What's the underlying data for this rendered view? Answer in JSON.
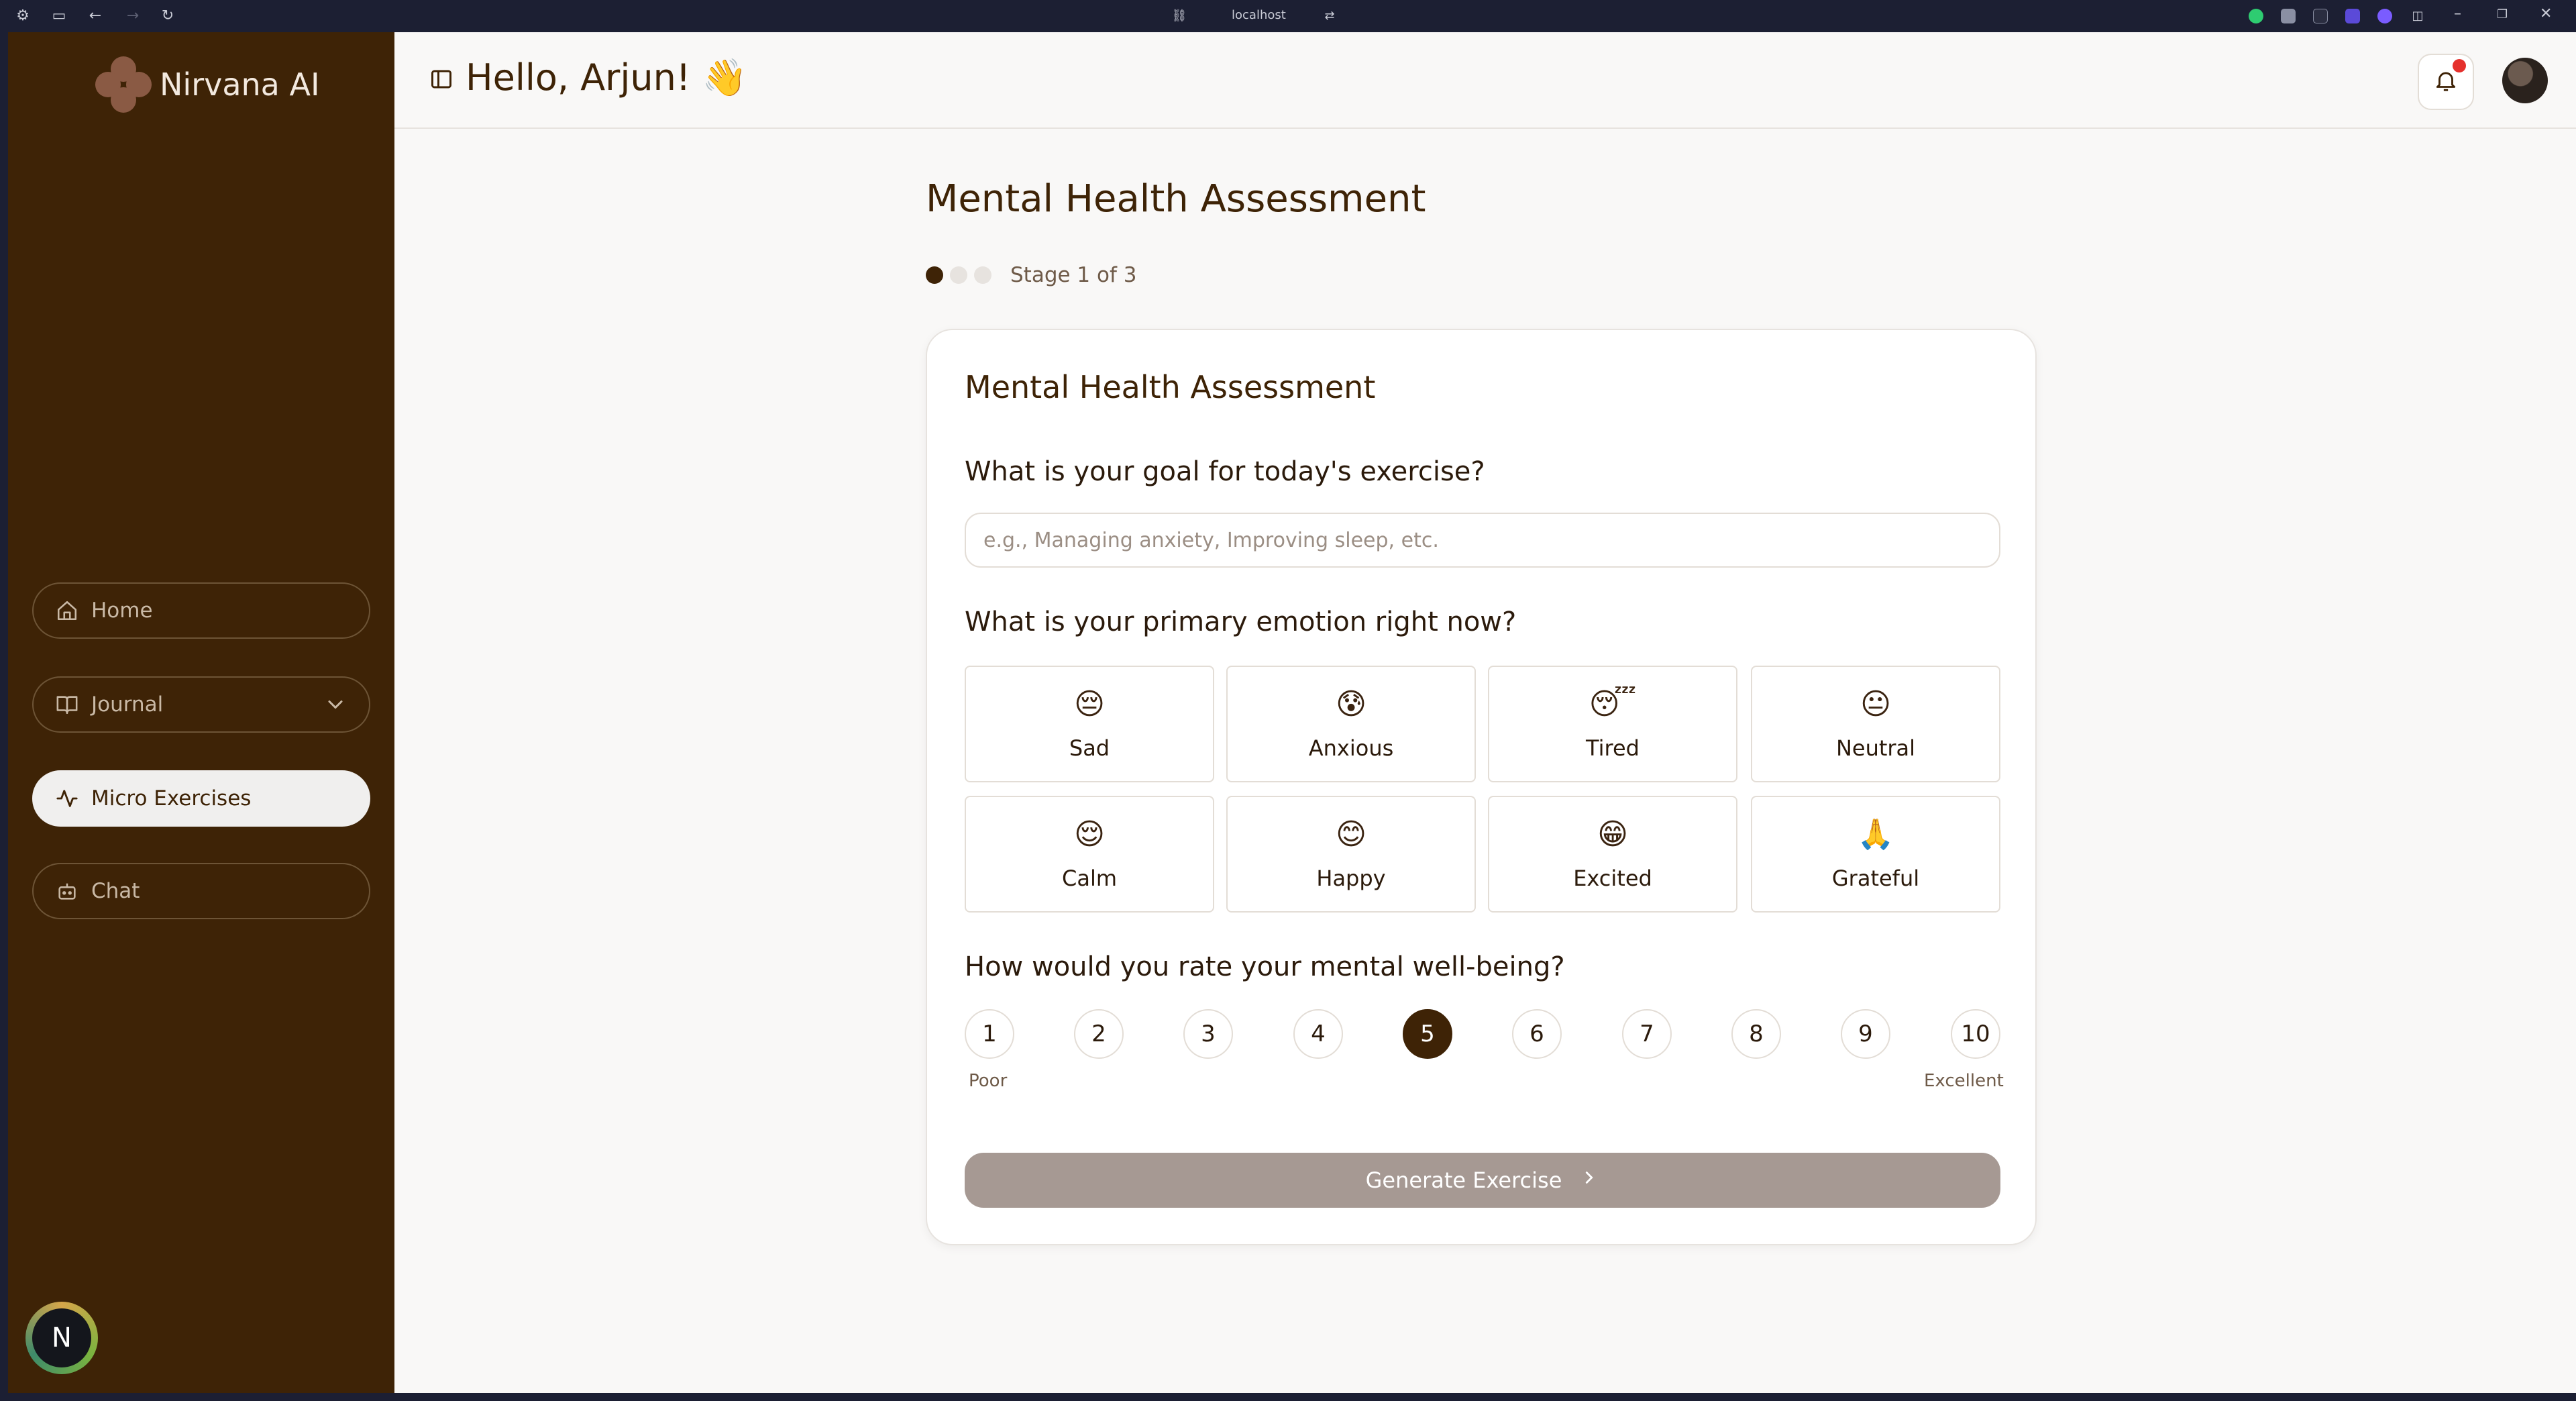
{
  "browser": {
    "url": "localhost"
  },
  "sidebar": {
    "brand": "Nirvana AI",
    "items": [
      {
        "label": "Home",
        "icon": "home-icon"
      },
      {
        "label": "Journal",
        "icon": "book-icon"
      },
      {
        "label": "Micro Exercises",
        "icon": "activity-icon",
        "active": true
      },
      {
        "label": "Chat",
        "icon": "bot-icon"
      }
    ],
    "badge_letter": "N"
  },
  "header": {
    "greeting": "Hello, Arjun! 👋"
  },
  "main": {
    "page_title": "Mental Health Assessment",
    "stage_text": "Stage 1 of 3",
    "card": {
      "title": "Mental Health Assessment",
      "goal_question": "What is your goal for today's exercise?",
      "goal_placeholder": "e.g., Managing anxiety, Improving sleep, etc.",
      "emotion_question": "What is your primary emotion right now?",
      "emotions": [
        {
          "label": "Sad",
          "emoji": "😔"
        },
        {
          "label": "Anxious",
          "emoji": "😰"
        },
        {
          "label": "Tired",
          "emoji": "😴"
        },
        {
          "label": "Neutral",
          "emoji": "😐"
        },
        {
          "label": "Calm",
          "emoji": "😌"
        },
        {
          "label": "Happy",
          "emoji": "😊"
        },
        {
          "label": "Excited",
          "emoji": "😁"
        },
        {
          "label": "Grateful",
          "emoji": "🙏"
        }
      ],
      "rating_question": "How would you rate your mental well-being?",
      "ratings": [
        "1",
        "2",
        "3",
        "4",
        "5",
        "6",
        "7",
        "8",
        "9",
        "10"
      ],
      "selected_rating": "5",
      "rating_low_label": "Poor",
      "rating_high_label": "Excellent",
      "generate_label": "Generate Exercise"
    }
  },
  "colors": {
    "sidebar_bg": "#3e2306",
    "accent": "#3e2306",
    "button_disabled": "#a69993",
    "notification_dot": "#e5302c"
  }
}
